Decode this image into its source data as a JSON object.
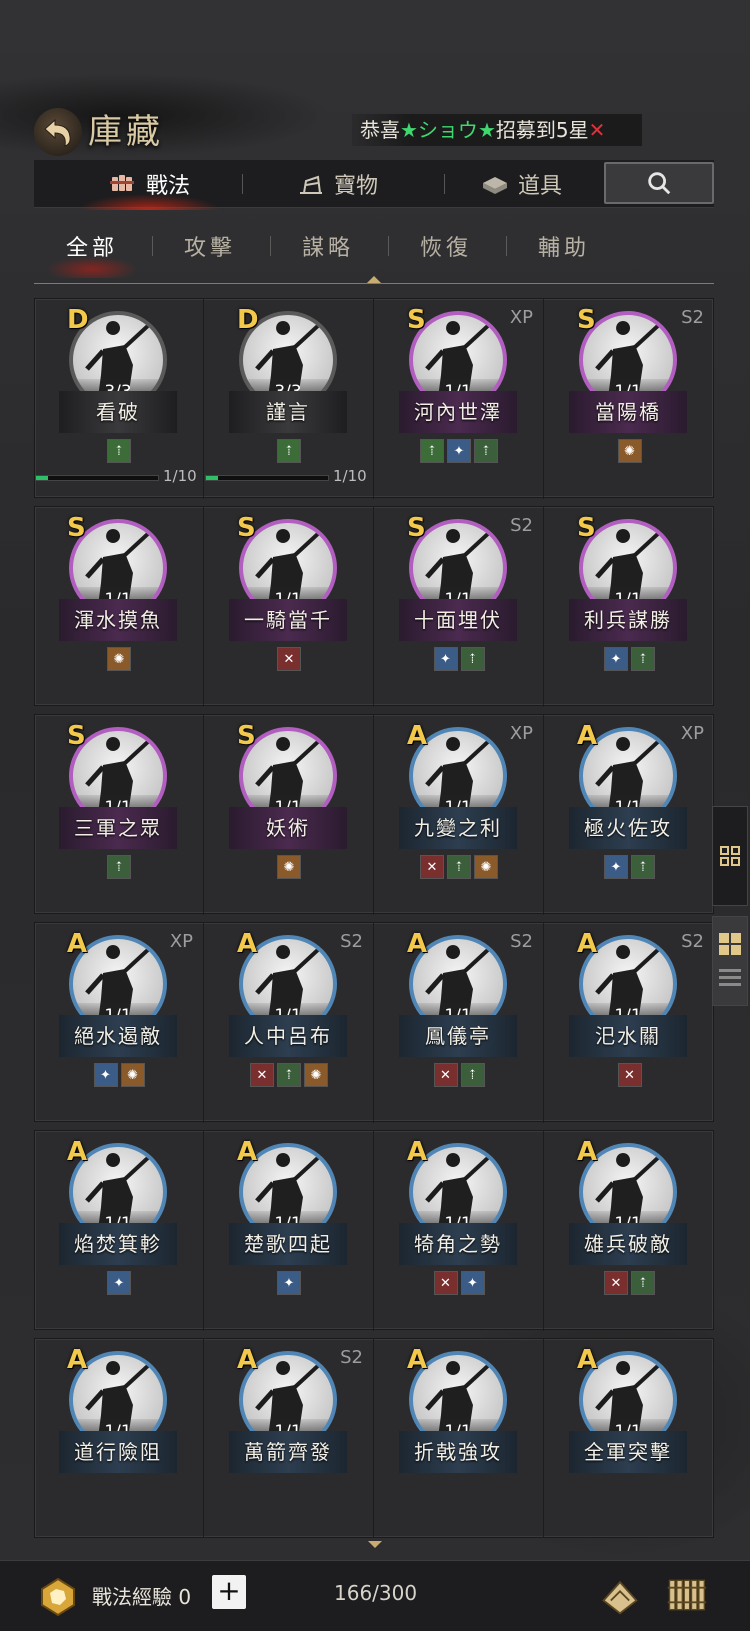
{
  "header": {
    "title": "庫藏",
    "announcement": {
      "prefix": "恭喜",
      "star": "★",
      "name": "ショウ",
      "suffix": "招募到5星",
      "close": "✕"
    }
  },
  "category_tabs": [
    {
      "label": "戰法",
      "icon": "tactics-icon",
      "active": true
    },
    {
      "label": "寶物",
      "icon": "treasure-icon",
      "active": false
    },
    {
      "label": "道具",
      "icon": "item-icon",
      "active": false
    }
  ],
  "sub_tabs": [
    {
      "label": "全部",
      "active": true
    },
    {
      "label": "攻擊",
      "active": false
    },
    {
      "label": "謀略",
      "active": false
    },
    {
      "label": "恢復",
      "active": false
    },
    {
      "label": "輔助",
      "active": false
    }
  ],
  "rows": [
    [
      {
        "grade": "D",
        "name": "看破",
        "count": "3/3",
        "tag": "",
        "ring": "gray",
        "exp": "1/10",
        "badges": [
          "green"
        ]
      },
      {
        "grade": "D",
        "name": "謹言",
        "count": "3/3",
        "tag": "",
        "ring": "gray",
        "exp": "1/10",
        "badges": [
          "green"
        ]
      },
      {
        "grade": "S",
        "name": "河內世澤",
        "count": "1/1",
        "tag": "XP",
        "ring": "pink",
        "badges": [
          "green",
          "blue",
          "dgreen"
        ]
      },
      {
        "grade": "S",
        "name": "當陽橋",
        "count": "1/1",
        "tag": "S2",
        "ring": "pink",
        "badges": [
          "orange"
        ]
      }
    ],
    [
      {
        "grade": "S",
        "name": "渾水摸魚",
        "count": "1/1",
        "tag": "",
        "ring": "pink",
        "badges": [
          "orange"
        ]
      },
      {
        "grade": "S",
        "name": "一騎當千",
        "count": "1/1",
        "tag": "",
        "ring": "pink",
        "badges": [
          "red"
        ]
      },
      {
        "grade": "S",
        "name": "十面埋伏",
        "count": "1/1",
        "tag": "S2",
        "ring": "pink",
        "badges": [
          "blue",
          "dgreen"
        ]
      },
      {
        "grade": "S",
        "name": "利兵謀勝",
        "count": "1/1",
        "tag": "",
        "ring": "pink",
        "badges": [
          "blue",
          "dgreen"
        ]
      }
    ],
    [
      {
        "grade": "S",
        "name": "三軍之眾",
        "count": "1/1",
        "tag": "",
        "ring": "pink",
        "badges": [
          "dgreen"
        ]
      },
      {
        "grade": "S",
        "name": "妖術",
        "count": "1/1",
        "tag": "",
        "ring": "pink",
        "badges": [
          "orange"
        ]
      },
      {
        "grade": "A",
        "name": "九變之利",
        "count": "1/1",
        "tag": "XP",
        "ring": "blue",
        "badges": [
          "red",
          "dgreen",
          "orange"
        ]
      },
      {
        "grade": "A",
        "name": "極火佐攻",
        "count": "1/1",
        "tag": "XP",
        "ring": "blue",
        "badges": [
          "blue",
          "dgreen"
        ]
      }
    ],
    [
      {
        "grade": "A",
        "name": "絕水遏敵",
        "count": "1/1",
        "tag": "XP",
        "ring": "blue",
        "badges": [
          "blue",
          "orange"
        ]
      },
      {
        "grade": "A",
        "name": "人中呂布",
        "count": "1/1",
        "tag": "S2",
        "ring": "blue",
        "badges": [
          "red",
          "dgreen",
          "orange"
        ]
      },
      {
        "grade": "A",
        "name": "鳳儀亭",
        "count": "1/1",
        "tag": "S2",
        "ring": "blue",
        "badges": [
          "red",
          "dgreen"
        ]
      },
      {
        "grade": "A",
        "name": "汜水關",
        "count": "1/1",
        "tag": "S2",
        "ring": "blue",
        "badges": [
          "red"
        ]
      }
    ],
    [
      {
        "grade": "A",
        "name": "焰焚箕軫",
        "count": "1/1",
        "tag": "",
        "ring": "blue",
        "badges": [
          "blue"
        ]
      },
      {
        "grade": "A",
        "name": "楚歌四起",
        "count": "1/1",
        "tag": "",
        "ring": "blue",
        "badges": [
          "blue"
        ]
      },
      {
        "grade": "A",
        "name": "犄角之勢",
        "count": "1/1",
        "tag": "",
        "ring": "blue",
        "badges": [
          "red",
          "blue"
        ]
      },
      {
        "grade": "A",
        "name": "雄兵破敵",
        "count": "1/1",
        "tag": "",
        "ring": "blue",
        "badges": [
          "red",
          "dgreen"
        ]
      }
    ],
    [
      {
        "grade": "A",
        "name": "道行險阻",
        "count": "1/1",
        "tag": "",
        "ring": "blue",
        "badges": []
      },
      {
        "grade": "A",
        "name": "萬箭齊發",
        "count": "1/1",
        "tag": "S2",
        "ring": "blue",
        "badges": []
      },
      {
        "grade": "A",
        "name": "折戟強攻",
        "count": "1/1",
        "tag": "",
        "ring": "blue",
        "badges": []
      },
      {
        "grade": "A",
        "name": "全軍突擊",
        "count": "1/1",
        "tag": "",
        "ring": "blue",
        "badges": []
      }
    ]
  ],
  "footer": {
    "tactic_exp_label": "戰法經驗 0",
    "plus": "+",
    "capacity": "166/300"
  },
  "colors": {
    "grade": "#f3c94b",
    "accent_red": "#e0323a",
    "star_green": "#3fd86e"
  }
}
